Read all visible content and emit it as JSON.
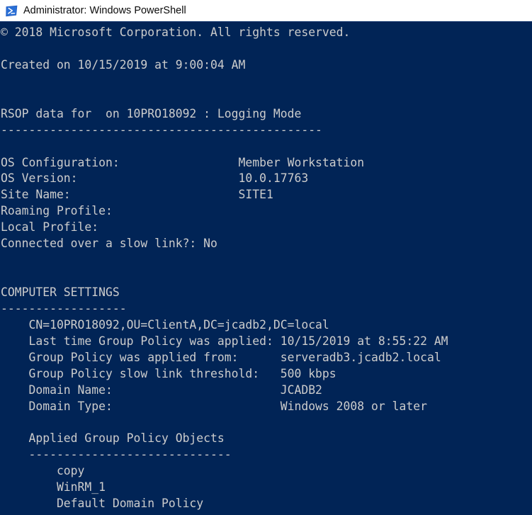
{
  "window": {
    "title": "Administrator: Windows PowerShell",
    "icon": "powershell-icon",
    "titlebar_bg": "#ffffff",
    "titlebar_text_color": "#0a0a0a",
    "console_bg": "#012456",
    "console_text_color": "#cccccc"
  },
  "console": {
    "lines": [
      "© 2018 Microsoft Corporation. All rights reserved.",
      "",
      "Created on ‎10/‎15/‎2019 at 9:00:04 AM",
      "",
      "",
      "RSOP data for  on 10PRO18092 : Logging Mode",
      "----------------------------------------------",
      "",
      "OS Configuration:                 Member Workstation",
      "OS Version:                       10.0.17763",
      "Site Name:                        SITE1",
      "Roaming Profile:",
      "Local Profile:",
      "Connected over a slow link?: No",
      "",
      "",
      "COMPUTER SETTINGS",
      "------------------",
      "    CN=10PRO18092,OU=ClientA,DC=jcadb2,DC=local",
      "    Last time Group Policy was applied: 10/15/2019 at 8:55:22 AM",
      "    Group Policy was applied from:      serveradb3.jcadb2.local",
      "    Group Policy slow link threshold:   500 kbps",
      "    Domain Name:                        JCADB2",
      "    Domain Type:                        Windows 2008 or later",
      "",
      "    Applied Group Policy Objects",
      "    -----------------------------",
      "        copy",
      "        WinRM_1",
      "        Default Domain Policy"
    ],
    "sections": {
      "copyright": "© 2018 Microsoft Corporation. All rights reserved.",
      "created_on": "Created on ‎10/‎15/‎2019 at 9:00:04 AM",
      "rsop_header": "RSOP data for  on 10PRO18092 : Logging Mode",
      "computer_settings_header": "COMPUTER SETTINGS",
      "applied_gpo_header": "Applied Group Policy Objects"
    },
    "fields": {
      "os_configuration_label": "OS Configuration:",
      "os_configuration_value": "Member Workstation",
      "os_version_label": "OS Version:",
      "os_version_value": "10.0.17763",
      "site_name_label": "Site Name:",
      "site_name_value": "SITE1",
      "roaming_profile_label": "Roaming Profile:",
      "roaming_profile_value": "",
      "local_profile_label": "Local Profile:",
      "local_profile_value": "",
      "slow_link_label": "Connected over a slow link?:",
      "slow_link_value": "No",
      "distinguished_name": "CN=10PRO18092,OU=ClientA,DC=jcadb2,DC=local",
      "last_applied_label": "Last time Group Policy was applied:",
      "last_applied_value": "10/15/2019 at 8:55:22 AM",
      "applied_from_label": "Group Policy was applied from:",
      "applied_from_value": "serveradb3.jcadb2.local",
      "slow_link_threshold_label": "Group Policy slow link threshold:",
      "slow_link_threshold_value": "500 kbps",
      "domain_name_label": "Domain Name:",
      "domain_name_value": "JCADB2",
      "domain_type_label": "Domain Type:",
      "domain_type_value": "Windows 2008 or later"
    },
    "applied_gpos": [
      "copy",
      "WinRM_1",
      "Default Domain Policy"
    ]
  }
}
